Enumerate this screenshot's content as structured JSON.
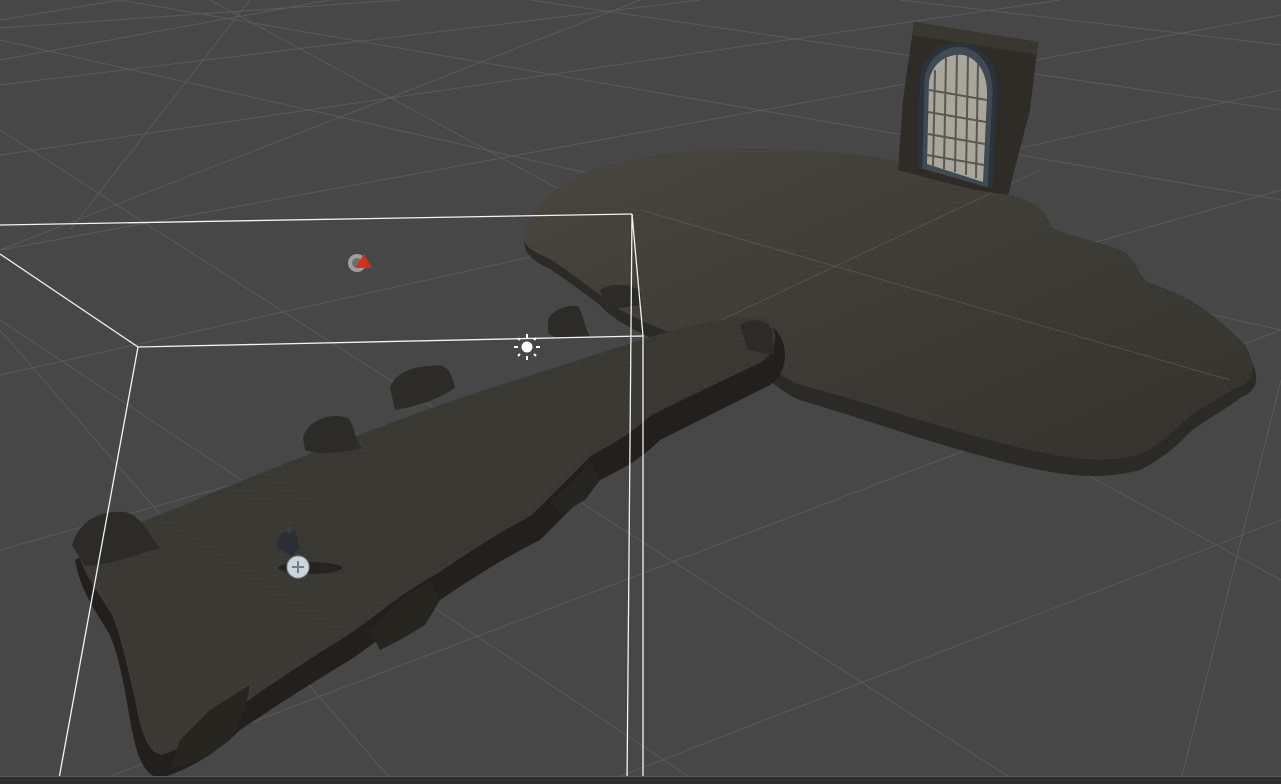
{
  "view": {
    "kind": "scene-view",
    "background_color": "#474747",
    "grid_line_color": "#5a5a5a",
    "grid_visible": true
  },
  "scene_objects": [
    {
      "name": "rock-platform",
      "description_color": "#3a3833"
    },
    {
      "name": "stone-walkway",
      "description_color": "#37352f"
    },
    {
      "name": "portcullis-doorway",
      "frame_color": "#2f2c27",
      "gate_color": "#b9b7ae"
    }
  ],
  "gizmos": [
    {
      "name": "camera-gizmo-icon",
      "accent_color": "#d2301f"
    },
    {
      "name": "light-gizmo-icon",
      "accent_color": "#ffffff"
    },
    {
      "name": "camera-frustum",
      "line_color": "#f2f2f2"
    },
    {
      "name": "player-character",
      "accent_color": "#cdd6dc"
    }
  ]
}
